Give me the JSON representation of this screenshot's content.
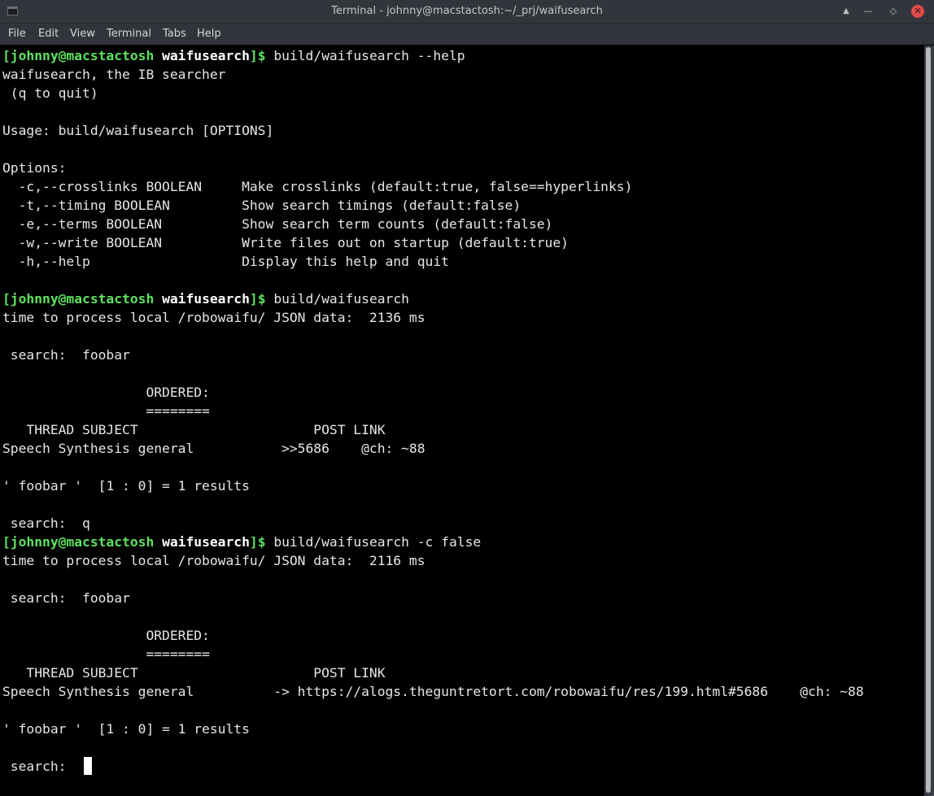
{
  "window": {
    "title": "Terminal - johnny@macstactosh:~/_prj/waifusearch",
    "icons": {
      "app": "terminal-icon",
      "up": "up-triangle-icon",
      "min": "minimize-icon",
      "max": "maximize-icon",
      "close": "close-icon"
    },
    "glyphs": {
      "up": "▲",
      "min": "—",
      "max": "◇",
      "close": "✕"
    },
    "close_color": "#e04a4a"
  },
  "menu": [
    "File",
    "Edit",
    "View",
    "Terminal",
    "Tabs",
    "Help"
  ],
  "prompt": {
    "user": "[johnny@macstactosh",
    "dir": "waifusearch",
    "tail": "]$ "
  },
  "lines": [
    {
      "type": "prompt",
      "cmd": "build/waifusearch --help"
    },
    {
      "type": "text",
      "text": "waifusearch, the IB searcher"
    },
    {
      "type": "text",
      "text": " (q to quit)"
    },
    {
      "type": "text",
      "text": ""
    },
    {
      "type": "text",
      "text": "Usage: build/waifusearch [OPTIONS]"
    },
    {
      "type": "text",
      "text": ""
    },
    {
      "type": "text",
      "text": "Options:"
    },
    {
      "type": "text",
      "text": "  -c,--crosslinks BOOLEAN     Make crosslinks (default:true, false==hyperlinks)"
    },
    {
      "type": "text",
      "text": "  -t,--timing BOOLEAN         Show search timings (default:false)"
    },
    {
      "type": "text",
      "text": "  -e,--terms BOOLEAN          Show search term counts (default:false)"
    },
    {
      "type": "text",
      "text": "  -w,--write BOOLEAN          Write files out on startup (default:true)"
    },
    {
      "type": "text",
      "text": "  -h,--help                   Display this help and quit"
    },
    {
      "type": "text",
      "text": ""
    },
    {
      "type": "prompt",
      "cmd": "build/waifusearch"
    },
    {
      "type": "text",
      "text": "time to process local /robowaifu/ JSON data:  2136 ms"
    },
    {
      "type": "text",
      "text": ""
    },
    {
      "type": "text",
      "text": " search:  foobar"
    },
    {
      "type": "text",
      "text": ""
    },
    {
      "type": "text",
      "text": "                  ORDERED:"
    },
    {
      "type": "text",
      "text": "                  ========"
    },
    {
      "type": "text",
      "text": "   THREAD SUBJECT                      POST LINK"
    },
    {
      "type": "text",
      "text": "Speech Synthesis general           >>5686    @ch: ~88"
    },
    {
      "type": "text",
      "text": ""
    },
    {
      "type": "text",
      "text": "' foobar '  [1 : 0] = 1 results"
    },
    {
      "type": "text",
      "text": ""
    },
    {
      "type": "text",
      "text": " search:  q"
    },
    {
      "type": "prompt",
      "cmd": "build/waifusearch -c false"
    },
    {
      "type": "text",
      "text": "time to process local /robowaifu/ JSON data:  2116 ms"
    },
    {
      "type": "text",
      "text": ""
    },
    {
      "type": "text",
      "text": " search:  foobar"
    },
    {
      "type": "text",
      "text": ""
    },
    {
      "type": "text",
      "text": "                  ORDERED:"
    },
    {
      "type": "text",
      "text": "                  ========"
    },
    {
      "type": "text",
      "text": "   THREAD SUBJECT                      POST LINK"
    },
    {
      "type": "text",
      "text": "Speech Synthesis general          -> https://alogs.theguntretort.com/robowaifu/res/199.html#5686    @ch: ~88"
    },
    {
      "type": "text",
      "text": ""
    },
    {
      "type": "text",
      "text": "' foobar '  [1 : 0] = 1 results"
    },
    {
      "type": "text",
      "text": ""
    },
    {
      "type": "input",
      "text": " search:  "
    }
  ],
  "colors": {
    "prompt_user": "#5fe05f",
    "prompt_dir": "#ffffff",
    "text": "#e6e6e6",
    "background": "#000000"
  }
}
